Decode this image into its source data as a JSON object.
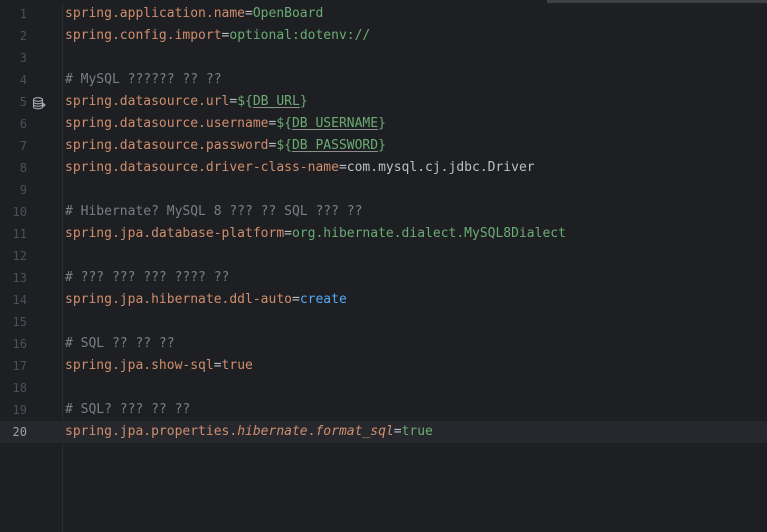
{
  "lines": [
    {
      "no": "1",
      "key": "spring.application.name",
      "eq": "=",
      "val": "OpenBoard"
    },
    {
      "no": "2",
      "key": "spring.config.import",
      "eq": "=",
      "val": "optional:dotenv://"
    },
    {
      "no": "3"
    },
    {
      "no": "4",
      "comment": "# MySQL ?????? ?? ??"
    },
    {
      "no": "5",
      "key": "spring.datasource.url",
      "eq": "=",
      "open": "${",
      "var": "DB_URL",
      "close": "}"
    },
    {
      "no": "6",
      "key": "spring.datasource.username",
      "eq": "=",
      "open": "${",
      "var": "DB_USERNAME",
      "close": "}"
    },
    {
      "no": "7",
      "key": "spring.datasource.password",
      "eq": "=",
      "open": "${",
      "var": "DB_PASSWORD",
      "close": "}"
    },
    {
      "no": "8",
      "key": "spring.datasource.driver-class-name",
      "eq": "=",
      "val": "com.mysql.cj.jdbc.Driver"
    },
    {
      "no": "9"
    },
    {
      "no": "10",
      "comment": "# Hibernate? MySQL 8 ??? ?? SQL ??? ??"
    },
    {
      "no": "11",
      "key": "spring.jpa.database-platform",
      "eq": "=",
      "val": "org.hibernate.dialect.MySQL8Dialect"
    },
    {
      "no": "12"
    },
    {
      "no": "13",
      "comment": "# ??? ??? ??? ???? ??"
    },
    {
      "no": "14",
      "key": "spring.jpa.hibernate.ddl-auto",
      "eq": "=",
      "val": "create"
    },
    {
      "no": "15"
    },
    {
      "no": "16",
      "comment": "# SQL ?? ?? ??"
    },
    {
      "no": "17",
      "key": "spring.jpa.show-sql",
      "eq": "=",
      "val": "true"
    },
    {
      "no": "18"
    },
    {
      "no": "19",
      "comment": "# SQL? ??? ?? ??"
    },
    {
      "no": "20",
      "key_a": "spring.jpa.properties.",
      "key_b": "hibernate",
      "key_c": ".",
      "key_d": "format_sql",
      "eq": "=",
      "val": "true"
    }
  ],
  "colors": {
    "background": "#1e1f22",
    "key": "#cf8e6d",
    "value": "#6aab73",
    "comment": "#7a7e85",
    "keyword": "#56a8f5",
    "current_line": "#26282e"
  },
  "gutter_icon": "database-icon"
}
